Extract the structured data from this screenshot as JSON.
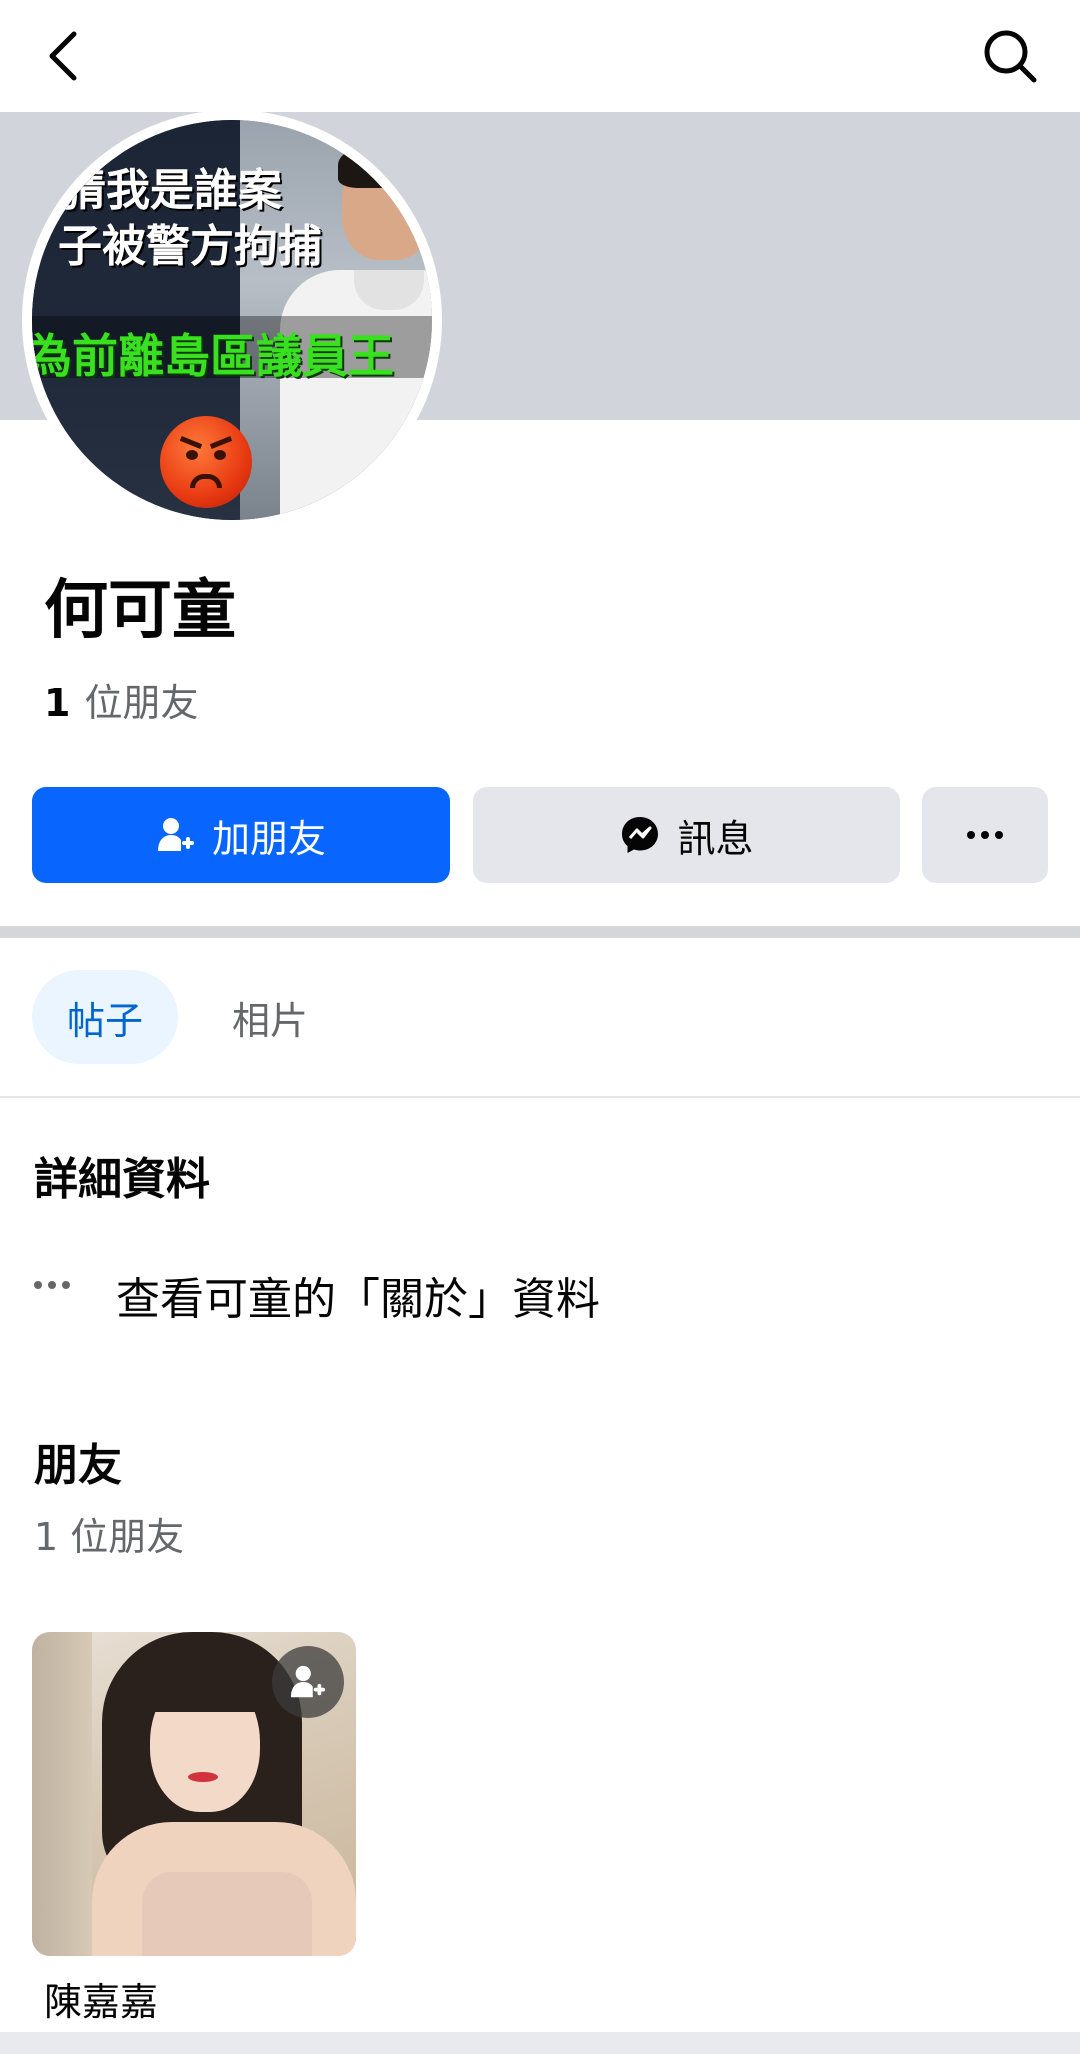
{
  "header": {
    "back_icon": "chevron-left-icon",
    "search_icon": "search-icon"
  },
  "profile": {
    "name": "何可童",
    "friend_count_number": "1",
    "friend_count_label": "位朋友",
    "avatar_overlay": {
      "line1": "猜我是誰案",
      "line2": "子被警方拘捕",
      "line3": "為前離島區議員王",
      "line4": "？"
    }
  },
  "actions": {
    "add_friend": "加朋友",
    "message": "訊息",
    "more": "···"
  },
  "tabs": {
    "posts": "帖子",
    "photos": "相片"
  },
  "details": {
    "title": "詳細資料",
    "about_link": "查看可童的「關於」資料"
  },
  "friends": {
    "title": "朋友",
    "subtitle": "1 位朋友",
    "items": [
      {
        "name": "陳嘉嘉"
      }
    ]
  },
  "colors": {
    "primary": "#0866ff",
    "secondary_button": "#e4e6eb",
    "cover": "#d1d5db",
    "tab_active_bg": "#ebf5ff",
    "tab_active_text": "#0064d1",
    "muted_text": "#65676b"
  }
}
